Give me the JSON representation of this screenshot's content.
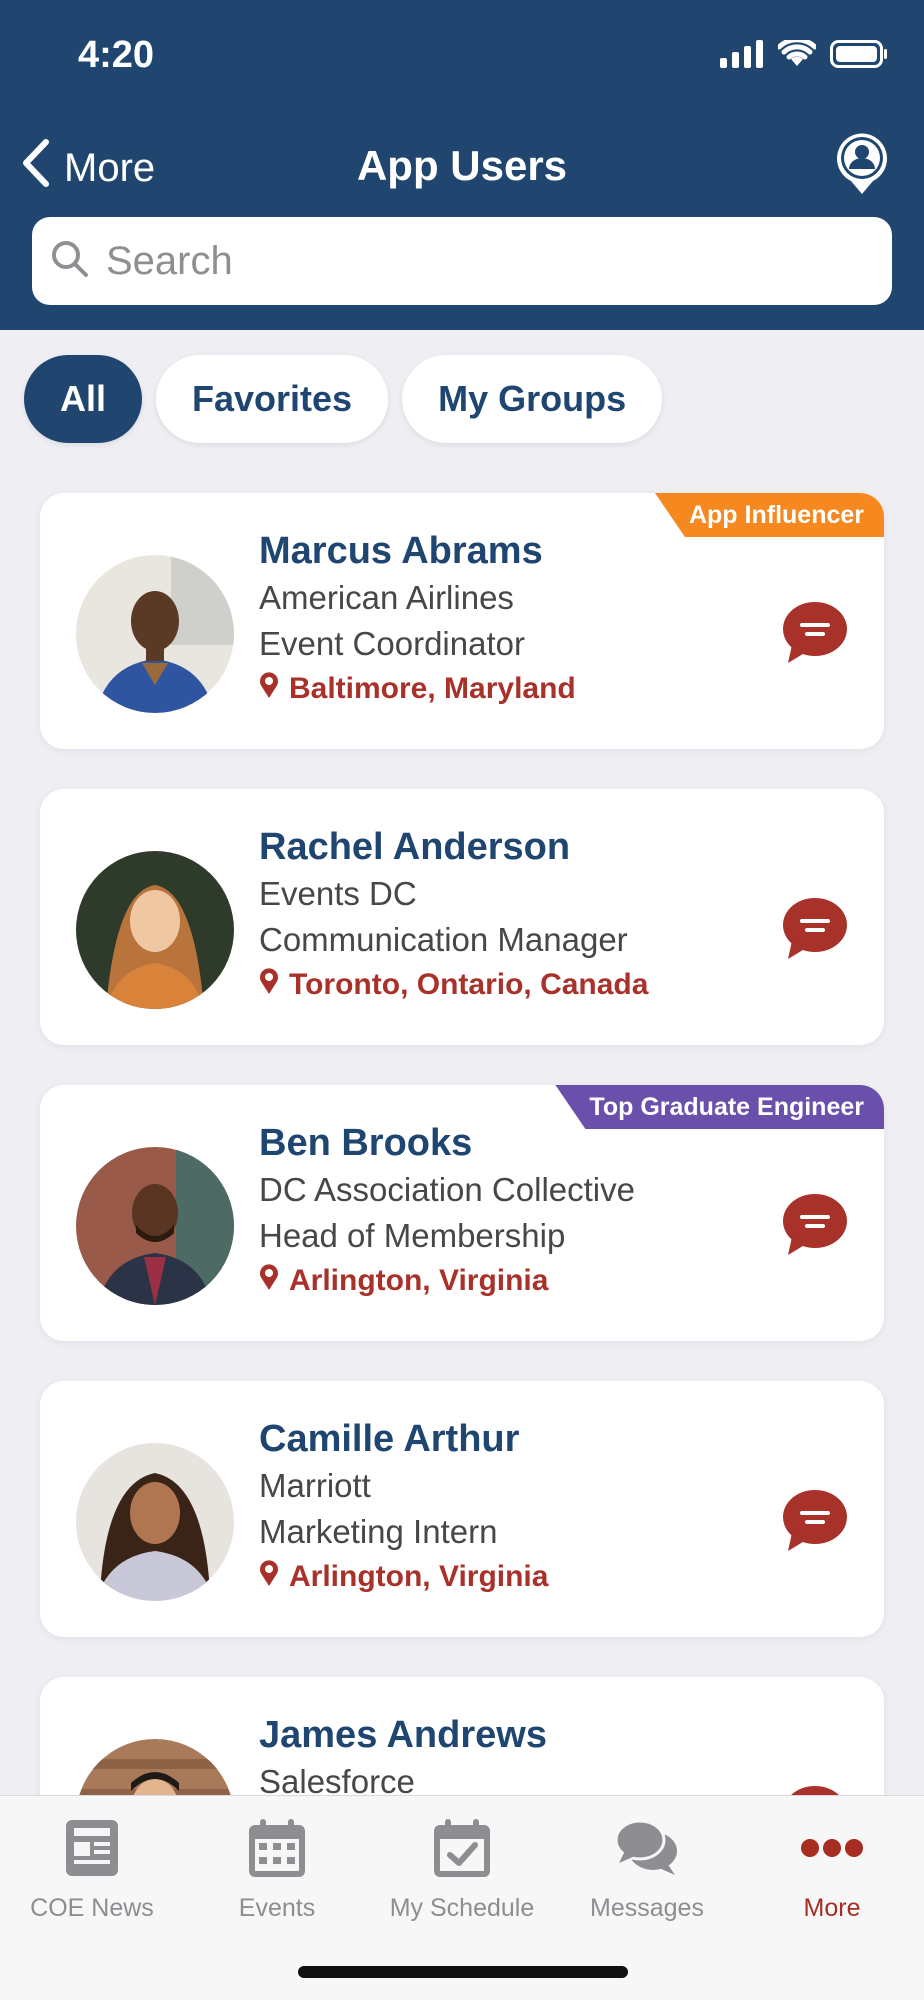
{
  "status_bar": {
    "time": "4:20"
  },
  "nav": {
    "back_label": "More",
    "title": "App Users"
  },
  "search": {
    "placeholder": "Search",
    "value": ""
  },
  "filters": [
    {
      "label": "All",
      "active": true
    },
    {
      "label": "Favorites",
      "active": false
    },
    {
      "label": "My Groups",
      "active": false
    }
  ],
  "users": [
    {
      "name": "Marcus Abrams",
      "company": "American Airlines",
      "title": "Event Coordinator",
      "location": "Baltimore, Maryland",
      "badge": "App Influencer",
      "badge_color": "#f5881f"
    },
    {
      "name": "Rachel Anderson",
      "company": "Events DC",
      "title": "Communication Manager",
      "location": "Toronto, Ontario, Canada",
      "badge": "",
      "badge_color": ""
    },
    {
      "name": "Ben Brooks",
      "company": "DC Association Collective",
      "title": "Head of Membership",
      "location": "Arlington, Virginia",
      "badge": "Top Graduate Engineer",
      "badge_color": "#6a4fab"
    },
    {
      "name": "Camille Arthur",
      "company": "Marriott",
      "title": "Marketing Intern",
      "location": "Arlington, Virginia",
      "badge": "",
      "badge_color": ""
    },
    {
      "name": "James Andrews",
      "company": "Salesforce",
      "title": "",
      "location": "",
      "badge": "",
      "badge_color": ""
    }
  ],
  "tabs": [
    {
      "label": "COE News",
      "icon": "news-icon"
    },
    {
      "label": "Events",
      "icon": "calendar-icon"
    },
    {
      "label": "My Schedule",
      "icon": "schedule-icon"
    },
    {
      "label": "Messages",
      "icon": "messages-icon"
    },
    {
      "label": "More",
      "icon": "more-icon",
      "active": true
    }
  ],
  "colors": {
    "primary": "#204670",
    "accent": "#a8312a",
    "background": "#eeeef3"
  }
}
